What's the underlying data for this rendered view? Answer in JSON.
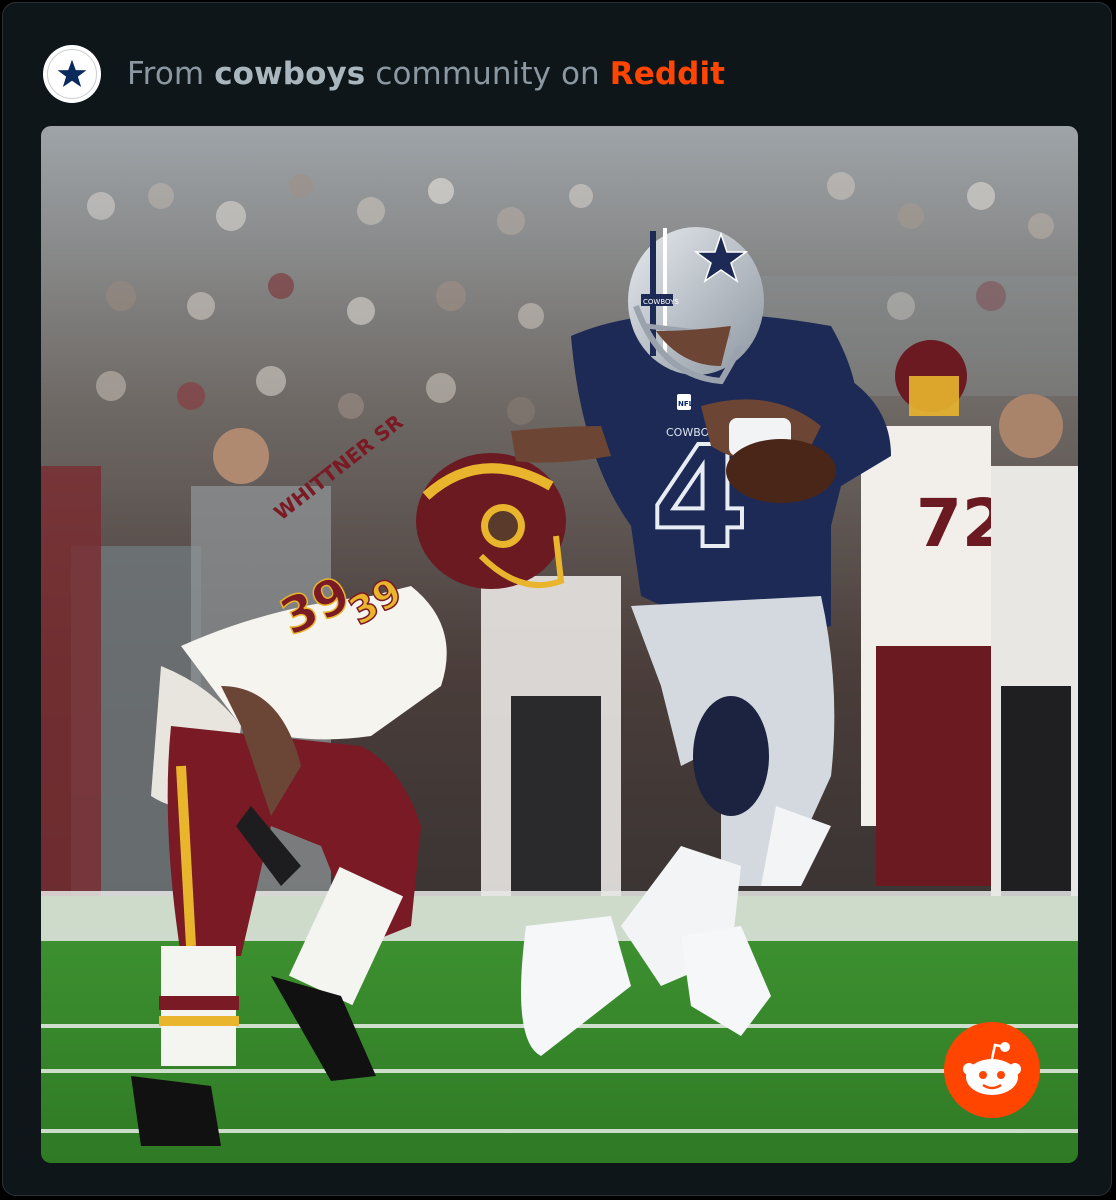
{
  "header": {
    "prefix": "From",
    "community": "cowboys",
    "middle": "community on",
    "platform": "Reddit"
  },
  "photo": {
    "defender_nameplate": "WHITTNER SR",
    "defender_number": "39",
    "runner_number": "4",
    "sideline_number": "72",
    "helmet_text": "COWBOYS",
    "jersey_text": "COWBOYS",
    "league_logo_text": "NFL"
  },
  "icons": {
    "avatar": "star-icon",
    "badge": "reddit-snoo-icon"
  },
  "colors": {
    "brand": "#ff4500",
    "card_background": "#0f161a",
    "muted_text": "#8b98a2",
    "cowboys_navy": "#1c2a55",
    "redskins_burgundy": "#6b1a22",
    "redskins_gold": "#e9b52d",
    "field_green": "#3a8a2c"
  }
}
